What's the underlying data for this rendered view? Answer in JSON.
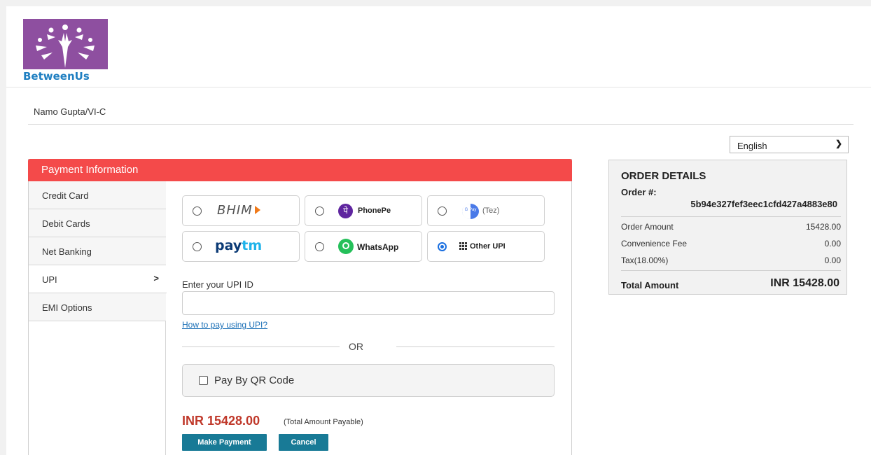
{
  "header": {
    "logo_text": "BetweenUs"
  },
  "student": {
    "name": "Namo Gupta/VI-C"
  },
  "language": {
    "selected": "English"
  },
  "payment": {
    "heading": "Payment Information",
    "sidebar": [
      {
        "label": "Credit Card"
      },
      {
        "label": "Debit Cards"
      },
      {
        "label": "Net Banking"
      },
      {
        "label": "UPI",
        "active": true
      },
      {
        "label": "EMI Options"
      }
    ],
    "upi_options": {
      "bhim": "BHIM",
      "phonepe": "PhonePe",
      "gpay_badge_g": "G",
      "gpay_badge_pay": "Pay",
      "gpay": "(Tez)",
      "paytm_pay": "pay",
      "paytm_tm": "tm",
      "whatsapp": "WhatsApp",
      "other": "Other UPI",
      "selected": "Other UPI"
    },
    "upi_label": "Enter your UPI ID",
    "upi_value": "",
    "howto": "How to pay using UPI?",
    "or": "OR",
    "qr_label": "Pay By QR Code",
    "amount": "INR 15428.00",
    "amount_note": "(Total Amount Payable)",
    "make_payment": "Make Payment",
    "cancel": "Cancel"
  },
  "order": {
    "title": "ORDER DETAILS",
    "order_label": "Order #:",
    "order_no": "5b94e327fef3eec1cfd427a4883e80",
    "rows": [
      {
        "label": "Order Amount",
        "value": "15428.00"
      },
      {
        "label": "Convenience Fee",
        "value": "0.00"
      },
      {
        "label": "Tax(18.00%)",
        "value": "0.00"
      }
    ],
    "total_label": "Total Amount",
    "total_value": "INR 15428.00"
  },
  "colors": {
    "header_red": "#f44a4a",
    "button_teal": "#187a96",
    "amount_red": "#c0392b",
    "logo_purple": "#8e4fa0"
  },
  "icons": [
    "chevron-down-icon",
    "chevron-right-icon",
    "phonepe-icon",
    "gpay-icon",
    "whatsapp-icon",
    "grid-icon"
  ]
}
